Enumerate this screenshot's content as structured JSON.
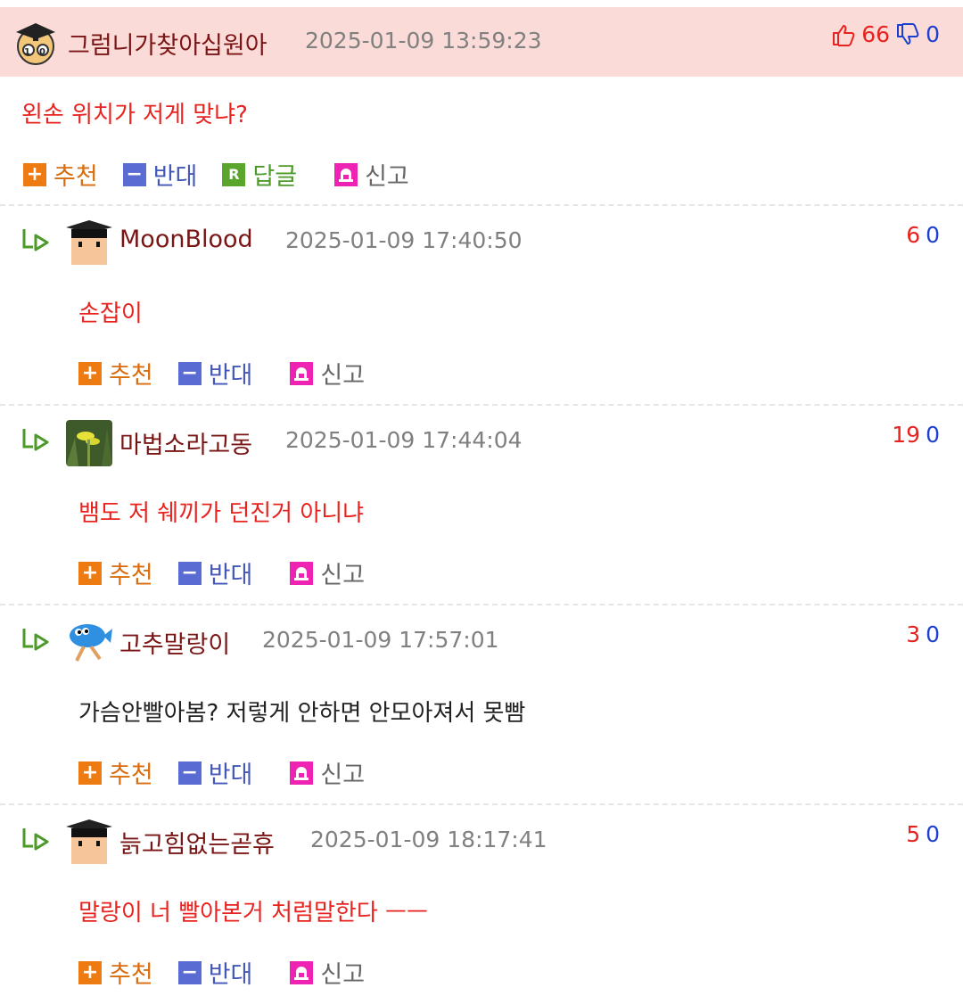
{
  "actions": {
    "recommend": "추천",
    "oppose": "반대",
    "reply": "답글",
    "report": "신고"
  },
  "top_comment": {
    "nickname": "그럼니가찾아십원아",
    "datetime": "2025-01-09 13:59:23",
    "upvotes": "66",
    "downvotes": "0",
    "text": "왼손 위치가 저게 맞냐?"
  },
  "replies": [
    {
      "nickname": "MoonBlood",
      "datetime": "2025-01-09 17:40:50",
      "upvotes": "6",
      "downvotes": "0",
      "text": "손잡이",
      "text_color": "red",
      "avatar": "student-avatar"
    },
    {
      "nickname": "마법소라고동",
      "datetime": "2025-01-09 17:44:04",
      "upvotes": "19",
      "downvotes": "0",
      "text": "뱀도 저 쉐끼가 던진거 아니냐",
      "text_color": "red",
      "avatar": "flower-photo-avatar"
    },
    {
      "nickname": "고추말랑이",
      "datetime": "2025-01-09 17:57:01",
      "upvotes": "3",
      "downvotes": "0",
      "text": "가슴안빨아봄? 저렇게 안하면 안모아져서 못빰",
      "text_color": "black",
      "avatar": "blue-fish-avatar"
    },
    {
      "nickname": "늙고힘없는곧휴",
      "datetime": "2025-01-09 18:17:41",
      "upvotes": "5",
      "downvotes": "0",
      "text": "말랑이 너 빨아본거 처럼말한다 ㅡㅡ",
      "text_color": "red",
      "avatar": "student-avatar"
    }
  ],
  "colors": {
    "header_bg": "#fbdbd8",
    "up": "#e8231f",
    "down": "#1c3fd0",
    "nick": "#7a1515"
  }
}
